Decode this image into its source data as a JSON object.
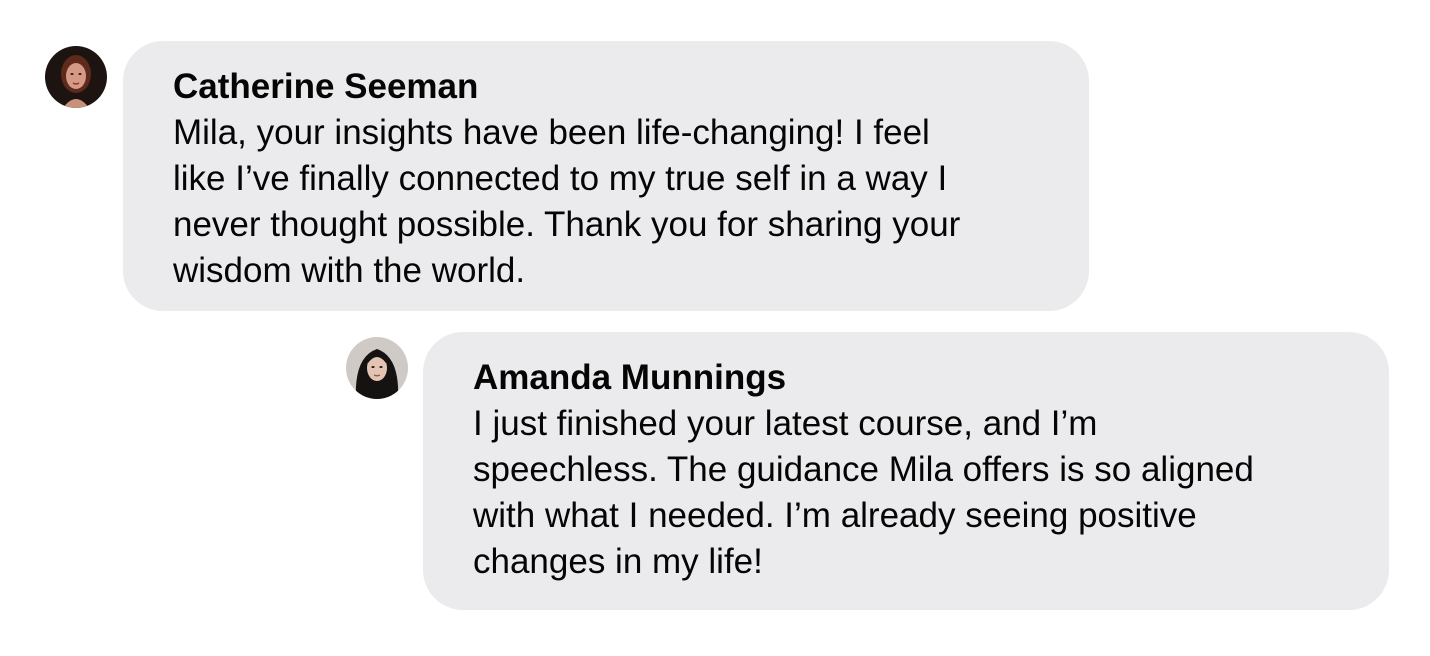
{
  "comments": [
    {
      "author": "Catherine Seeman",
      "lines": [
        "Mila, your insights have been life-changing! I feel",
        "like I’ve finally connected to my true self in a way I",
        "never thought possible. Thank you for sharing your",
        "wisdom with the world."
      ],
      "avatar_icon": "avatar-photo-icon"
    },
    {
      "author": "Amanda Munnings",
      "lines": [
        "I just finished your latest course, and I’m",
        "speechless. The guidance Mila offers is so aligned",
        "with what I needed. I’m already seeing positive",
        "changes in my life!"
      ],
      "avatar_icon": "avatar-photo-icon"
    }
  ],
  "colors": {
    "bubble_background": "#ebebed",
    "text": "#050505",
    "page_background": "#ffffff"
  }
}
